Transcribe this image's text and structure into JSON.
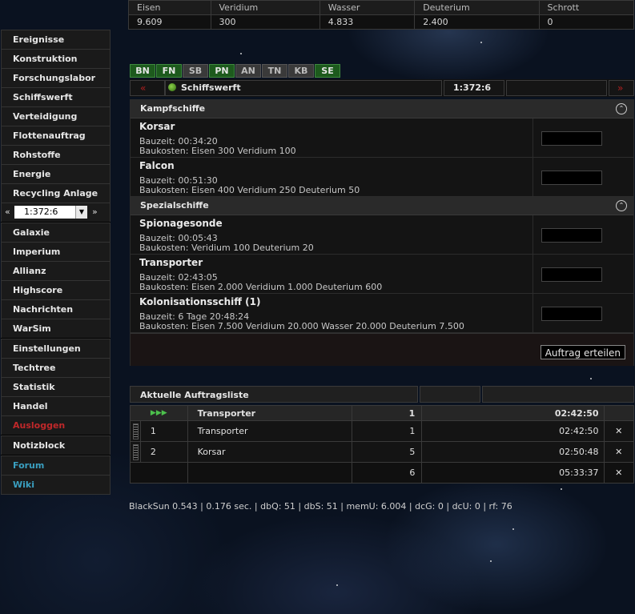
{
  "resources": {
    "headers": [
      "Eisen",
      "Veridium",
      "Wasser",
      "Deuterium",
      "Schrott"
    ],
    "values": [
      "9.609",
      "300",
      "4.833",
      "2.400",
      "0"
    ]
  },
  "menu": {
    "group1": [
      "Ereignisse",
      "Konstruktion",
      "Forschungslabor",
      "Schiffswerft",
      "Verteidigung",
      "Flottenauftrag",
      "Rohstoffe",
      "Energie",
      "Recycling Anlage"
    ],
    "planet": {
      "prev": "«",
      "value": "1:372:6",
      "next": "»"
    },
    "group2": [
      "Galaxie",
      "Imperium",
      "Allianz",
      "Highscore",
      "Nachrichten",
      "WarSim"
    ],
    "group3": [
      "Einstellungen",
      "Techtree",
      "Statistik",
      "Handel",
      "Ausloggen"
    ],
    "group4": [
      "Notizblock"
    ],
    "group5": [
      "Forum",
      "Wiki"
    ]
  },
  "tabs": [
    {
      "label": "BN",
      "active": true
    },
    {
      "label": "FN",
      "active": true
    },
    {
      "label": "SB",
      "active": false
    },
    {
      "label": "PN",
      "active": true
    },
    {
      "label": "AN",
      "active": false
    },
    {
      "label": "TN",
      "active": false
    },
    {
      "label": "KB",
      "active": false
    },
    {
      "label": "SE",
      "active": true
    }
  ],
  "shipyard": {
    "prev": "«",
    "title": "Schiffswerft",
    "coords": "1:372:6",
    "next": "»"
  },
  "sections": {
    "kampf": {
      "title": "Kampfschiffe",
      "ships": [
        {
          "name": "Korsar",
          "bauzeit": "Bauzeit: 00:34:20",
          "kosten": "Baukosten: Eisen 300 Veridium 100"
        },
        {
          "name": "Falcon",
          "bauzeit": "Bauzeit: 00:51:30",
          "kosten": "Baukosten: Eisen 400 Veridium 250 Deuterium 50"
        }
      ]
    },
    "spezial": {
      "title": "Spezialschiffe",
      "ships": [
        {
          "name": "Spionagesonde",
          "bauzeit": "Bauzeit: 00:05:43",
          "kosten": "Baukosten: Veridium 100 Deuterium 20"
        },
        {
          "name": "Transporter",
          "bauzeit": "Bauzeit: 02:43:05",
          "kosten": "Baukosten: Eisen 2.000 Veridium 1.000 Deuterium 600"
        },
        {
          "name": "Kolonisationsschiff (1)",
          "bauzeit": "Bauzeit: 6 Tage 20:48:24",
          "kosten": "Baukosten: Eisen 7.500 Veridium 20.000 Wasser 20.000 Deuterium 7.500"
        }
      ]
    }
  },
  "order_button": "Auftrag erteilen",
  "orders": {
    "title": "Aktuelle Auftragsliste",
    "current": {
      "play_icon": "▶▶▶",
      "name": "Transporter",
      "count": "1",
      "time": "02:42:50"
    },
    "rows": [
      {
        "idx": "1",
        "name": "Transporter",
        "count": "1",
        "time": "02:42:50"
      },
      {
        "idx": "2",
        "name": "Korsar",
        "count": "5",
        "time": "02:50:48"
      }
    ],
    "total": {
      "count": "6",
      "time": "05:33:37"
    },
    "delete_icon": "✕"
  },
  "footer": "BlackSun 0.543 | 0.176 sec. | dbQ: 51 | dbS: 51 | memU: 6.004 | dcG: 0 | dcU: 0 | rf: 76",
  "colors": {
    "accent_green": "#1d5a1d",
    "logout_red": "#c0282a",
    "link_blue": "#3a9fc0",
    "delete_red": "#c02020"
  }
}
